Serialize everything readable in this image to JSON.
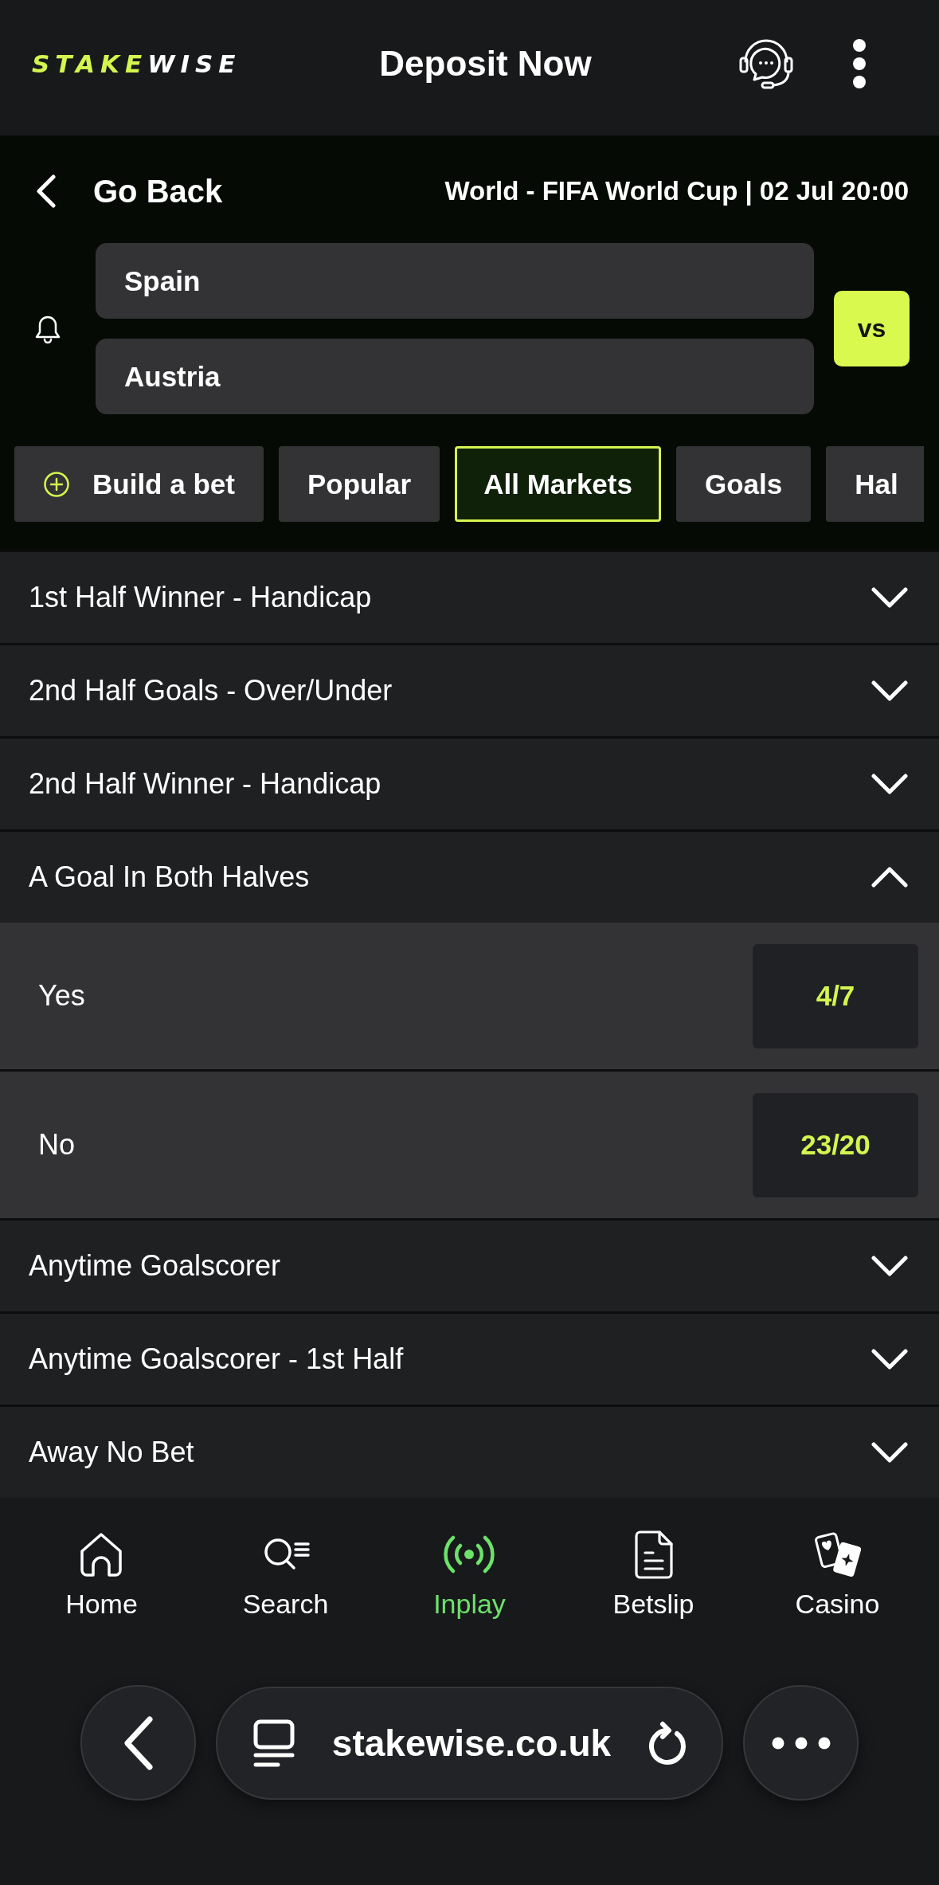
{
  "header": {
    "logo": {
      "accent": "STAKE",
      "rest": "WISE"
    },
    "title": "Deposit Now"
  },
  "event": {
    "back_label": "Go Back",
    "title": "World - FIFA World Cup | 02 Jul 20:00",
    "teams": [
      "Spain",
      "Austria"
    ],
    "vs_label": "vs"
  },
  "tabs": [
    {
      "label": "Build a bet",
      "kind": "builder",
      "selected": false
    },
    {
      "label": "Popular",
      "kind": "plain",
      "selected": false
    },
    {
      "label": "All Markets",
      "kind": "plain",
      "selected": true
    },
    {
      "label": "Goals",
      "kind": "plain",
      "selected": false
    },
    {
      "label": "Hal",
      "kind": "plain",
      "selected": false
    }
  ],
  "markets": [
    {
      "name": "1st Half Winner - Handicap",
      "expanded": false
    },
    {
      "name": "2nd Half Goals - Over/Under",
      "expanded": false
    },
    {
      "name": "2nd Half Winner - Handicap",
      "expanded": false
    },
    {
      "name": "A Goal In Both Halves",
      "expanded": true,
      "selections": [
        {
          "label": "Yes",
          "odds": "4/7"
        },
        {
          "label": "No",
          "odds": "23/20"
        }
      ]
    },
    {
      "name": "Anytime Goalscorer",
      "expanded": false
    },
    {
      "name": "Anytime Goalscorer - 1st Half",
      "expanded": false
    },
    {
      "name": "Away No Bet",
      "expanded": false
    }
  ],
  "bottom_nav": [
    {
      "label": "Home",
      "kind": "home",
      "selected": false
    },
    {
      "label": "Search",
      "kind": "search",
      "selected": false
    },
    {
      "label": "Inplay",
      "kind": "inplay",
      "selected": true
    },
    {
      "label": "Betslip",
      "kind": "betslip",
      "selected": false
    },
    {
      "label": "Casino",
      "kind": "casino",
      "selected": false
    }
  ],
  "browser_bar": {
    "url": "stakewise.co.uk"
  }
}
